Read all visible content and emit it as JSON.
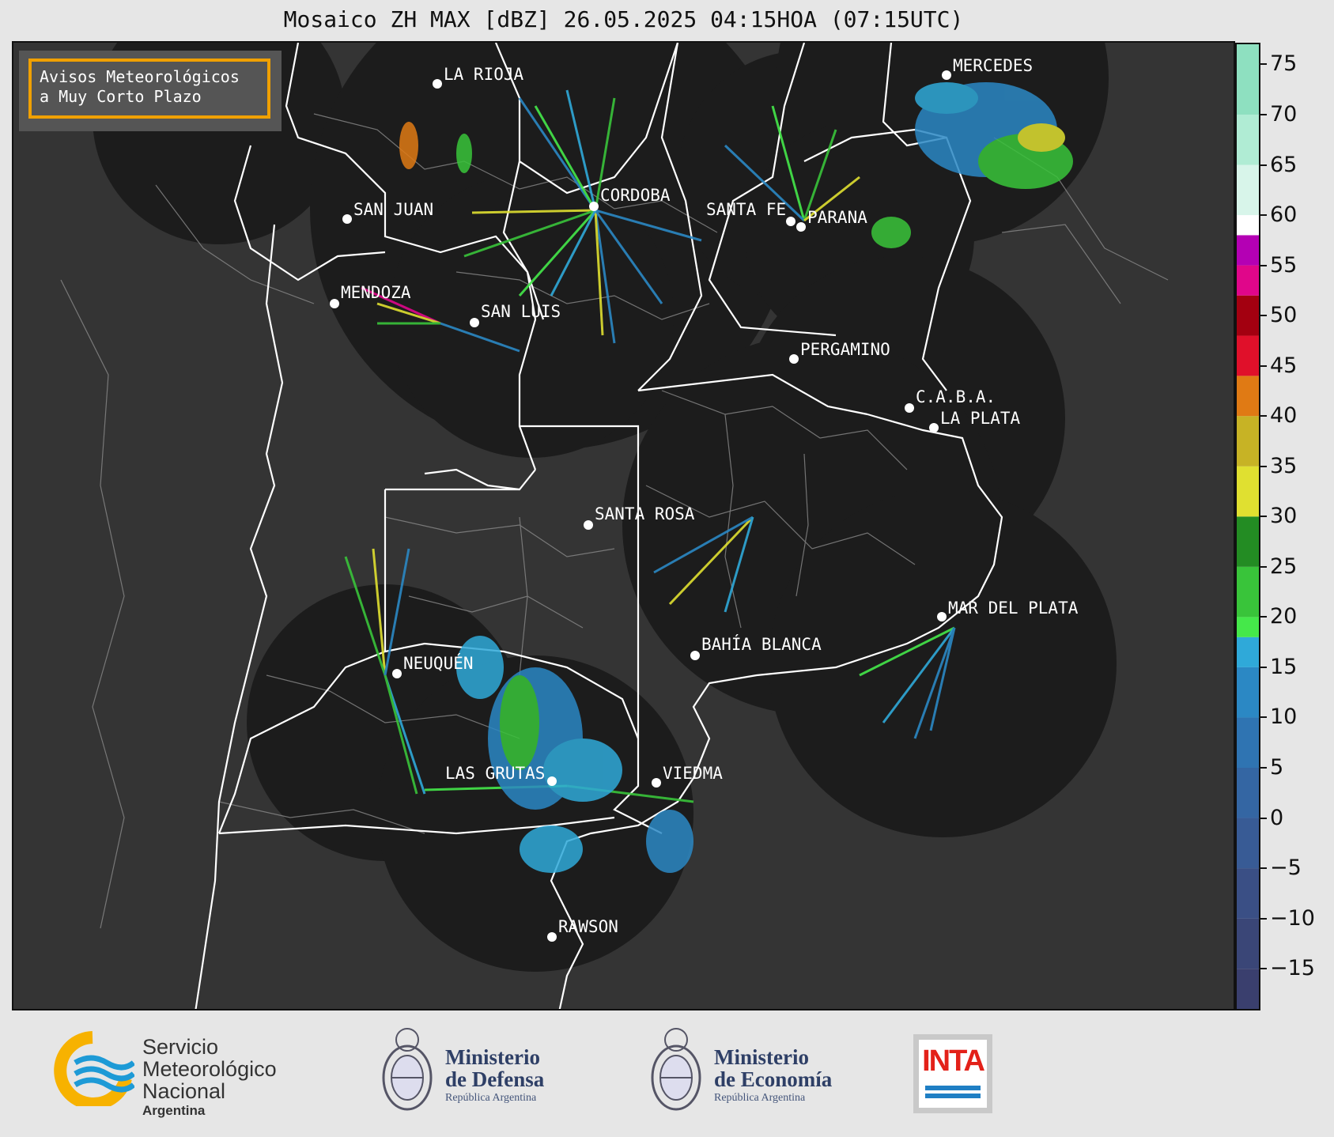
{
  "title": "Mosaico ZH MAX [dBZ] 26.05.2025 04:15HOA (07:15UTC)",
  "notice": {
    "line1": "Avisos Meteorológicos",
    "line2": "a Muy Corto Plazo"
  },
  "colors": {
    "map_background": "#343434",
    "radar_coverage": "#1c1c1c",
    "province_border": "#ffffff",
    "department_border": "#8a8a8a",
    "notice_border": "#f0a000"
  },
  "colorbar": {
    "unit": "dBZ",
    "min": -19,
    "max": 77,
    "ticks": [
      "75",
      "70",
      "65",
      "60",
      "55",
      "50",
      "45",
      "40",
      "35",
      "30",
      "25",
      "20",
      "15",
      "10",
      "5",
      "0",
      "−5",
      "−10",
      "−15"
    ],
    "tick_values": [
      75,
      70,
      65,
      60,
      55,
      50,
      45,
      40,
      35,
      30,
      25,
      20,
      15,
      10,
      5,
      0,
      -5,
      -10,
      -15
    ],
    "stops": [
      {
        "from": -19,
        "to": -15,
        "color": "#3a3f6e"
      },
      {
        "from": -15,
        "to": -10,
        "color": "#3a4677"
      },
      {
        "from": -10,
        "to": -5,
        "color": "#3a4f85"
      },
      {
        "from": -5,
        "to": 0,
        "color": "#385b95"
      },
      {
        "from": 0,
        "to": 5,
        "color": "#3466a3"
      },
      {
        "from": 5,
        "to": 10,
        "color": "#2f74b2"
      },
      {
        "from": 10,
        "to": 15,
        "color": "#2b88c4"
      },
      {
        "from": 15,
        "to": 18,
        "color": "#2fa9d9"
      },
      {
        "from": 18,
        "to": 20,
        "color": "#45e84a"
      },
      {
        "from": 20,
        "to": 25,
        "color": "#39c43a"
      },
      {
        "from": 25,
        "to": 30,
        "color": "#238c23"
      },
      {
        "from": 30,
        "to": 35,
        "color": "#e0e030"
      },
      {
        "from": 35,
        "to": 40,
        "color": "#c7b325"
      },
      {
        "from": 40,
        "to": 44,
        "color": "#e07a14"
      },
      {
        "from": 44,
        "to": 48,
        "color": "#e0102a"
      },
      {
        "from": 48,
        "to": 52,
        "color": "#a30010"
      },
      {
        "from": 52,
        "to": 55,
        "color": "#e0068a"
      },
      {
        "from": 55,
        "to": 58,
        "color": "#b400b4"
      },
      {
        "from": 58,
        "to": 60,
        "color": "#ffffff"
      },
      {
        "from": 60,
        "to": 65,
        "color": "#d8f5ea"
      },
      {
        "from": 65,
        "to": 70,
        "color": "#b0ecd4"
      },
      {
        "from": 70,
        "to": 77,
        "color": "#8ee0c0"
      }
    ]
  },
  "cities": [
    {
      "name": "LA RIOJA"
    },
    {
      "name": "CORDOBA"
    },
    {
      "name": "SAN JUAN"
    },
    {
      "name": "SANTA FE"
    },
    {
      "name": "PARANA"
    },
    {
      "name": "MERCEDES"
    },
    {
      "name": "MENDOZA"
    },
    {
      "name": "SAN LUIS"
    },
    {
      "name": "PERGAMINO"
    },
    {
      "name": "C.A.B.A."
    },
    {
      "name": "LA PLATA"
    },
    {
      "name": "SANTA ROSA"
    },
    {
      "name": "MAR DEL PLATA"
    },
    {
      "name": "BAHÍA BLANCA"
    },
    {
      "name": "NEUQUÉN"
    },
    {
      "name": "LAS GRUTAS"
    },
    {
      "name": "VIEDMA"
    },
    {
      "name": "RAWSON"
    }
  ],
  "logos": {
    "smn": {
      "line1": "Servicio",
      "line2": "Meteorológico",
      "line3": "Nacional",
      "line4": "Argentina"
    },
    "defensa": {
      "line1": "Ministerio",
      "line2": "de Defensa",
      "line3": "República Argentina"
    },
    "economia": {
      "line1": "Ministerio",
      "line2": "de Economía",
      "line3": "República Argentina"
    },
    "inta": {
      "text": "INTA"
    }
  }
}
